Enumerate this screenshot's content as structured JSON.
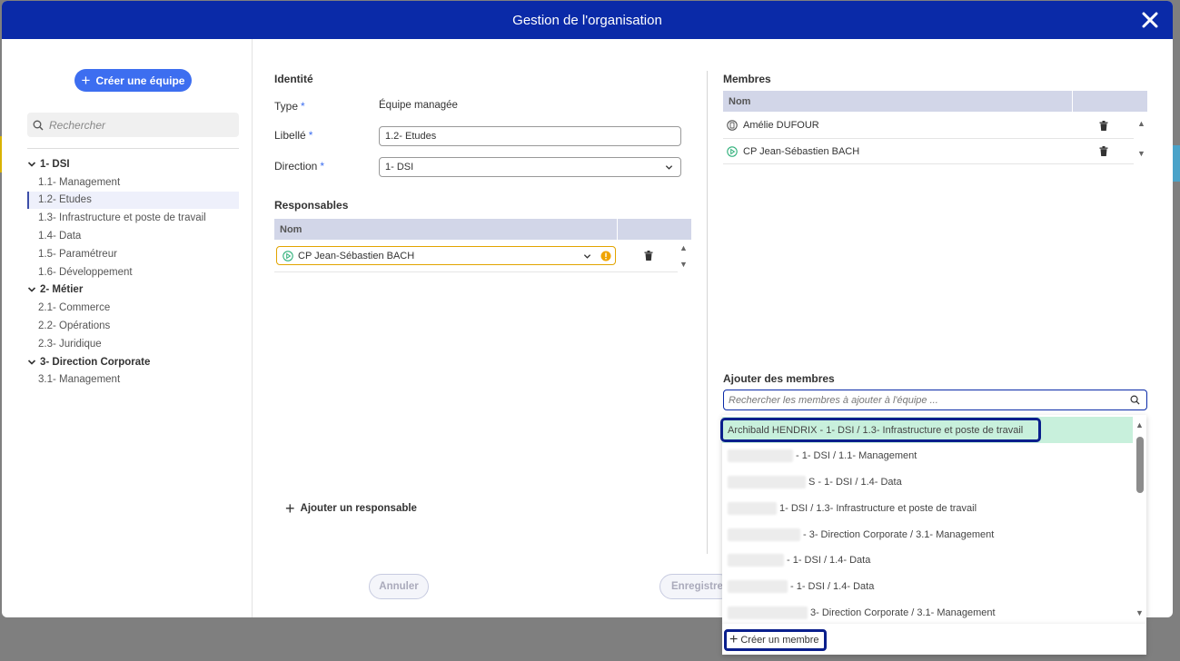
{
  "modal": {
    "title": "Gestion de l'organisation"
  },
  "left": {
    "create_team_label": "Créer une équipe",
    "search_placeholder": "Rechercher",
    "tree": [
      {
        "label": "1- DSI",
        "items": [
          "1.1- Management",
          "1.2- Etudes",
          "1.3- Infrastructure et poste de travail",
          "1.4- Data",
          "1.5- Paramétreur",
          "1.6- Développement"
        ]
      },
      {
        "label": "2- Métier",
        "items": [
          "2.1- Commerce",
          "2.2- Opérations",
          "2.3- Juridique"
        ]
      },
      {
        "label": "3- Direction Corporate",
        "items": [
          "3.1- Management"
        ]
      }
    ],
    "active_item": "1.2- Etudes"
  },
  "identity": {
    "section_title": "Identité",
    "type_label": "Type",
    "type_value": "Équipe managée",
    "libelle_label": "Libellé",
    "libelle_value": "1.2- Etudes",
    "direction_label": "Direction",
    "direction_value": "1- DSI",
    "required_mark": "*"
  },
  "responsables": {
    "section_title": "Responsables",
    "col_name": "Nom",
    "rows": [
      {
        "name": "CP Jean-Sébastien BACH"
      }
    ],
    "add_label": "Ajouter un responsable"
  },
  "buttons": {
    "cancel": "Annuler",
    "save": "Enregistrer"
  },
  "membres": {
    "section_title": "Membres",
    "col_name": "Nom",
    "rows": [
      {
        "name": "Amélie DUFOUR",
        "icon": "badge-icon"
      },
      {
        "name": "CP Jean-Sébastien BACH",
        "icon": "play-circle-icon"
      }
    ]
  },
  "add_members": {
    "section_title": "Ajouter des membres",
    "search_placeholder": "Rechercher les membres à ajouter à l'équipe ...",
    "results": [
      {
        "text": "Archibald HENDRIX - 1- DSI / 1.3- Infrastructure et poste de travail"
      },
      {
        "text": "- 1- DSI / 1.1- Management"
      },
      {
        "text": "S - 1- DSI / 1.4- Data"
      },
      {
        "text": "1- DSI / 1.3- Infrastructure et poste de travail"
      },
      {
        "text": "- 3- Direction Corporate / 3.1- Management"
      },
      {
        "text": "- 1- DSI / 1.4- Data"
      },
      {
        "text": "- 1- DSI / 1.4- Data"
      },
      {
        "text": "3- Direction Corporate / 3.1- Management"
      }
    ],
    "create_member_label": "Créer un membre"
  },
  "colors": {
    "header": "#0a2aa8",
    "accent": "#3d6ef0",
    "highlight": "#c8f0dc",
    "outline": "#0a1f8c"
  }
}
